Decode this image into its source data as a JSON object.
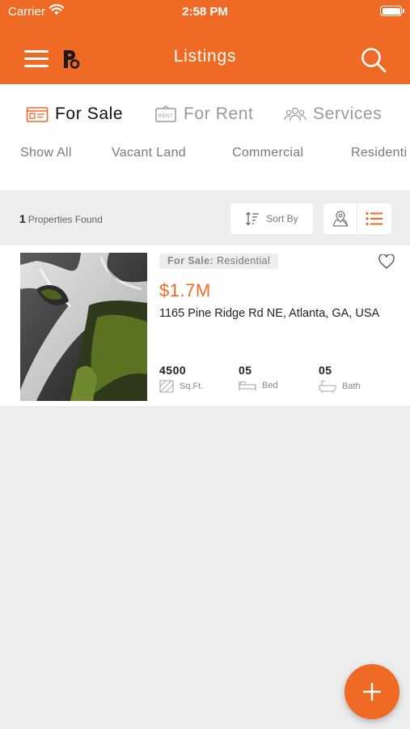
{
  "status_bar": {
    "carrier": "Carrier",
    "time": "2:58 PM"
  },
  "header": {
    "title": "Listings"
  },
  "main_tabs": [
    {
      "label": "For Sale",
      "icon": "for-sale-icon",
      "active": true
    },
    {
      "label": "For Rent",
      "icon": "rent-sign-icon",
      "active": false
    },
    {
      "label": "Services",
      "icon": "people-icon",
      "active": false
    }
  ],
  "rent_icon_text": "RENT",
  "sub_tabs": [
    "Show All",
    "Vacant Land",
    "Commercial",
    "Residenti"
  ],
  "results": {
    "count": "1",
    "label": "Properties Found"
  },
  "sort": {
    "label": "Sort By"
  },
  "listing": {
    "badge_type": "For Sale:",
    "badge_category": "Residential",
    "price": "$1.7M",
    "address": "1165 Pine Ridge Rd NE, Atlanta, GA, USA",
    "sqft": {
      "value": "4500",
      "label": "Sq.Ft."
    },
    "bed": {
      "value": "05",
      "label": "Bed"
    },
    "bath": {
      "value": "05",
      "label": "Bath"
    }
  },
  "colors": {
    "accent": "#ee6a25",
    "background": "#ededed"
  }
}
